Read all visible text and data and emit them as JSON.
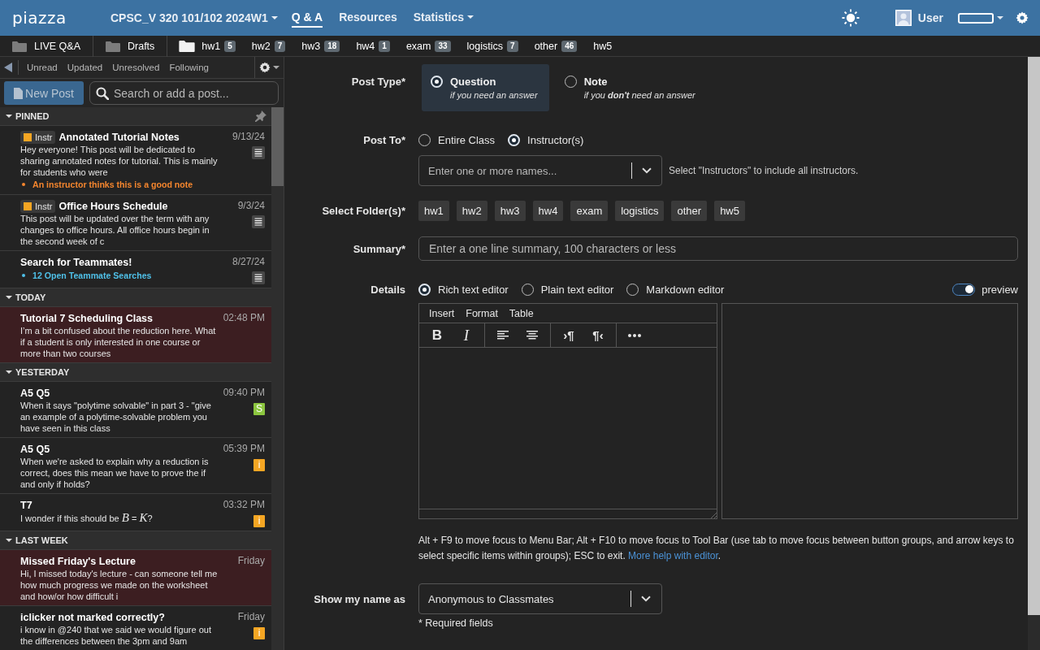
{
  "top_bar": {
    "logo": "piazza",
    "course": "CPSC_V 320 101/102 2024W1",
    "nav": [
      {
        "label": "Q & A",
        "selected": true,
        "dropdown": false
      },
      {
        "label": "Resources",
        "selected": false,
        "dropdown": false
      },
      {
        "label": "Statistics",
        "selected": false,
        "dropdown": true
      }
    ],
    "user": "User"
  },
  "folder_bar": {
    "pinned": [
      {
        "label": "LIVE Q&A"
      },
      {
        "label": "Drafts"
      }
    ],
    "folders": [
      {
        "label": "hw1",
        "count": "5"
      },
      {
        "label": "hw2",
        "count": "7"
      },
      {
        "label": "hw3",
        "count": "18"
      },
      {
        "label": "hw4",
        "count": "1"
      },
      {
        "label": "exam",
        "count": "33"
      },
      {
        "label": "logistics",
        "count": "7"
      },
      {
        "label": "other",
        "count": "46"
      },
      {
        "label": "hw5"
      }
    ]
  },
  "sidebar": {
    "filters": [
      {
        "label": "Unread",
        "selected": false
      },
      {
        "label": "Updated",
        "selected": false
      },
      {
        "label": "Unresolved",
        "selected": false
      },
      {
        "label": "Following",
        "selected": false
      }
    ],
    "new_post": "New Post",
    "search": {
      "placeholder": "Search or add a post..."
    },
    "groups": [
      {
        "label": "PINNED",
        "kind": "pinned",
        "expanded": true,
        "posts": [
          {
            "tag": "Instr",
            "title": "Annotated Tutorial Notes",
            "time": "9/13/24",
            "snippet": "Hey everyone! This post will be dedicated to sharing annotated notes for tutorial. This is mainly for students who were",
            "footnote": {
              "text": "An instructor thinks this is a good note",
              "color": "#f5862e"
            },
            "unread": false,
            "badge": {
              "kind": "note"
            }
          },
          {
            "tag": "Instr",
            "title": "Office Hours Schedule",
            "time": "9/3/24",
            "snippet": "This post will be updated over the term with any changes to office hours. All office hours begin in the second week of c",
            "unread": false,
            "badge": {
              "kind": "note"
            }
          },
          {
            "title": "Search for Teammates!",
            "time": "8/27/24",
            "footnote": {
              "text": "12 Open Teammate Searches",
              "color": "#4fc0e8"
            },
            "unread": false,
            "badge": {
              "kind": "note"
            }
          }
        ]
      },
      {
        "label": "TODAY",
        "kind": "date",
        "expanded": true,
        "posts": [
          {
            "title": "Tutorial 7 Scheduling Class",
            "time": "02:48 PM",
            "snippet": "I’m a bit confused about the reduction here. What if a student is only interested in one course or more than two courses",
            "unread": true
          }
        ]
      },
      {
        "label": "YESTERDAY",
        "kind": "date",
        "expanded": true,
        "posts": [
          {
            "title": "A5 Q5",
            "time": "09:40 PM",
            "snippet": "When it says \"polytime solvable\" in part 3 - \"give an example of a polytime-solvable problem you have seen in this class",
            "unread": false,
            "badge": {
              "kind": "letter",
              "text": "S",
              "color": "#8cc63f"
            }
          },
          {
            "title": "A5 Q5",
            "time": "05:39 PM",
            "snippet": "When we're asked to explain why a reduction is correct, does this mean we have to prove the if and only if holds?",
            "unread": false,
            "badge": {
              "kind": "letter",
              "text": "i",
              "color": "#f5a623"
            }
          },
          {
            "title": "T7",
            "time": "03:32 PM",
            "snippet": "I wonder if this should be *B* = *K*?",
            "unread": false,
            "badge": {
              "kind": "letter",
              "text": "i",
              "color": "#f5a623"
            }
          }
        ]
      },
      {
        "label": "LAST WEEK",
        "kind": "date",
        "expanded": true,
        "posts": [
          {
            "title": "Missed Friday's Lecture",
            "time": "Friday",
            "snippet": "Hi, I missed today's lecture - can someone tell me how much progress we made on the worksheet and how/or how difficult i",
            "unread": true
          },
          {
            "title": "iclicker not marked correctly?",
            "time": "Friday",
            "snippet": "i know in @240 that we said we would figure out the differences between the 3pm and 9am",
            "unread": false,
            "badge": {
              "kind": "letter",
              "text": "i",
              "color": "#f5a623"
            }
          }
        ]
      }
    ]
  },
  "form": {
    "post_type": {
      "label": "Post Type*",
      "options": [
        {
          "title": "Question",
          "subtitle": "if you need an answer",
          "selected": true
        },
        {
          "title": "Note",
          "subtitle": "if you **don't** need an answer",
          "selected": false
        }
      ]
    },
    "post_to": {
      "label": "Post To*",
      "options": [
        {
          "label": "Entire Class",
          "selected": false
        },
        {
          "label": "Instructor(s)",
          "selected": true
        }
      ],
      "recipients": {
        "placeholder": "Enter one or more names..."
      },
      "hint": "Select \"Instructors\" to include all instructors."
    },
    "folders": {
      "label": "Select Folder(s)*",
      "options": [
        {
          "label": "hw1",
          "selected": false
        },
        {
          "label": "hw2",
          "selected": false
        },
        {
          "label": "hw3",
          "selected": false
        },
        {
          "label": "hw4",
          "selected": false
        },
        {
          "label": "exam",
          "selected": false
        },
        {
          "label": "logistics",
          "selected": false
        },
        {
          "label": "other",
          "selected": false
        },
        {
          "label": "hw5",
          "selected": false
        }
      ]
    },
    "summary": {
      "label": "Summary*",
      "placeholder": "Enter a one line summary, 100 characters or less"
    },
    "details": {
      "label": "Details",
      "editors": [
        {
          "label": "Rich text editor",
          "selected": true
        },
        {
          "label": "Plain text editor",
          "selected": false
        },
        {
          "label": "Markdown editor",
          "selected": false
        }
      ],
      "preview": {
        "label": "preview",
        "on": true
      },
      "menu": [
        "Insert",
        "Format",
        "Table"
      ],
      "toolbar": [
        [
          {
            "kind": "bold",
            "glyph": "B"
          },
          {
            "kind": "italic",
            "glyph": "I"
          }
        ],
        [
          {
            "kind": "align_left"
          },
          {
            "kind": "align_center"
          }
        ],
        [
          {
            "kind": "ltr",
            "glyph": "›¶"
          },
          {
            "kind": "rtl",
            "glyph": "¶‹"
          }
        ],
        [
          {
            "kind": "more"
          }
        ]
      ],
      "help": {
        "text": "Alt + F9 to move focus to Menu Bar; Alt + F10 to move focus to Tool Bar (use tab to move focus between button groups, and arrow keys to select specific items within groups); ESC to exit.",
        "link": "More help with editor",
        "after": "."
      }
    },
    "name_as": {
      "label": "Show my name as",
      "value": "Anonymous to Classmates"
    },
    "required_note": "* Required fields"
  }
}
